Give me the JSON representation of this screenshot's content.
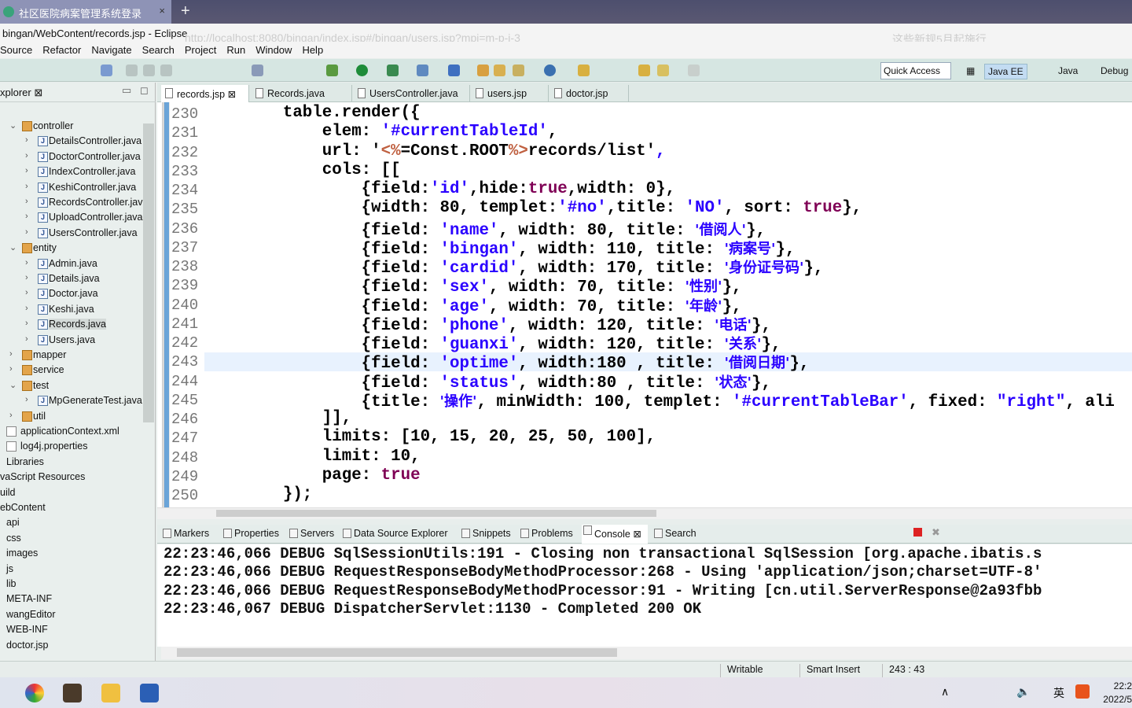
{
  "browser": {
    "tab_title": "社区医院病案管理系统登录",
    "close": "×",
    "new_tab": "+",
    "url": "http://localhost:8080/bingan/index.jsp#/bingan/users.jsp?mpi=m-p-i-3",
    "news": "这些新规5月起施行"
  },
  "window": {
    "title": "bingan/WebContent/records.jsp - Eclipse"
  },
  "menu": [
    "Source",
    "Refactor",
    "Navigate",
    "Search",
    "Project",
    "Run",
    "Window",
    "Help"
  ],
  "toolbar": {
    "quick_access": "Quick Access",
    "perspectives": [
      "Java EE",
      "Java",
      "Debug"
    ]
  },
  "explorer": {
    "title": "xplorer ⊠",
    "items": [
      {
        "label": "controller",
        "level": 1,
        "type": "pkg",
        "open": true
      },
      {
        "label": "DetailsController.java",
        "level": 2,
        "type": "java"
      },
      {
        "label": "DoctorController.java",
        "level": 2,
        "type": "java"
      },
      {
        "label": "IndexController.java",
        "level": 2,
        "type": "java"
      },
      {
        "label": "KeshiController.java",
        "level": 2,
        "type": "java"
      },
      {
        "label": "RecordsController.java",
        "level": 2,
        "type": "java"
      },
      {
        "label": "UploadController.java",
        "level": 2,
        "type": "java"
      },
      {
        "label": "UsersController.java",
        "level": 2,
        "type": "java"
      },
      {
        "label": "entity",
        "level": 1,
        "type": "pkg",
        "open": true
      },
      {
        "label": "Admin.java",
        "level": 2,
        "type": "java"
      },
      {
        "label": "Details.java",
        "level": 2,
        "type": "java"
      },
      {
        "label": "Doctor.java",
        "level": 2,
        "type": "java"
      },
      {
        "label": "Keshi.java",
        "level": 2,
        "type": "java"
      },
      {
        "label": "Records.java",
        "level": 2,
        "type": "java",
        "selected": true
      },
      {
        "label": "Users.java",
        "level": 2,
        "type": "java"
      },
      {
        "label": "mapper",
        "level": 1,
        "type": "pkg"
      },
      {
        "label": "service",
        "level": 1,
        "type": "pkg"
      },
      {
        "label": "test",
        "level": 1,
        "type": "pkg",
        "open": true
      },
      {
        "label": "MpGenerateTest.java",
        "level": 2,
        "type": "java"
      },
      {
        "label": "util",
        "level": 1,
        "type": "pkg"
      },
      {
        "label": "applicationContext.xml",
        "level": 0.5,
        "type": "file"
      },
      {
        "label": "log4j.properties",
        "level": 0.5,
        "type": "file"
      },
      {
        "label": "Libraries",
        "level": 0,
        "type": "none"
      },
      {
        "label": "vaScript Resources",
        "level": -1,
        "type": "none"
      },
      {
        "label": "uild",
        "level": -1,
        "type": "none"
      },
      {
        "label": "ebContent",
        "level": -1,
        "type": "none"
      },
      {
        "label": "api",
        "level": 0,
        "type": "none"
      },
      {
        "label": "css",
        "level": 0,
        "type": "none"
      },
      {
        "label": "images",
        "level": 0,
        "type": "none"
      },
      {
        "label": "js",
        "level": 0,
        "type": "none"
      },
      {
        "label": "lib",
        "level": 0,
        "type": "none"
      },
      {
        "label": "META-INF",
        "level": 0,
        "type": "none"
      },
      {
        "label": "wangEditor",
        "level": 0,
        "type": "none"
      },
      {
        "label": "WEB-INF",
        "level": 0,
        "type": "none"
      },
      {
        "label": "doctor.jsp",
        "level": 0,
        "type": "none"
      }
    ]
  },
  "editor_tabs": [
    {
      "label": "records.jsp ⊠",
      "active": true
    },
    {
      "label": "Records.java"
    },
    {
      "label": "UsersController.java"
    },
    {
      "label": "users.jsp"
    },
    {
      "label": "doctor.jsp"
    }
  ],
  "code": {
    "first_line": 230,
    "current_line": 243,
    "lines": [
      [
        [
          "p",
          "        table.render({"
        ]
      ],
      [
        [
          "p",
          "            elem: "
        ],
        [
          "s",
          "'#currentTableId'"
        ],
        [
          "p",
          ","
        ]
      ],
      [
        [
          "p",
          "            url: '"
        ],
        [
          "j",
          "<%"
        ],
        [
          "p",
          "=Const.ROOT"
        ],
        [
          "j",
          "%>"
        ],
        [
          "p",
          "records/list'"
        ],
        [
          "s",
          ","
        ]
      ],
      [
        [
          "p",
          "            cols: [["
        ]
      ],
      [
        [
          "p",
          "                {field:"
        ],
        [
          "s",
          "'id'"
        ],
        [
          "p",
          ",hide:"
        ],
        [
          "k",
          "true"
        ],
        [
          "p",
          ",width: 0},"
        ]
      ],
      [
        [
          "p",
          "                {width: 80, templet:"
        ],
        [
          "s",
          "'#no'"
        ],
        [
          "p",
          ",title: "
        ],
        [
          "s",
          "'NO'"
        ],
        [
          "p",
          ", sort: "
        ],
        [
          "k",
          "true"
        ],
        [
          "p",
          "},"
        ]
      ],
      [
        [
          "p",
          "                {field: "
        ],
        [
          "s",
          "'name'"
        ],
        [
          "p",
          ", width: 80, title: "
        ],
        [
          "z",
          "'借阅人'"
        ],
        [
          "p",
          "},"
        ]
      ],
      [
        [
          "p",
          "                {field: "
        ],
        [
          "s",
          "'bingan'"
        ],
        [
          "p",
          ", width: 110, title: "
        ],
        [
          "z",
          "'病案号'"
        ],
        [
          "p",
          "},"
        ]
      ],
      [
        [
          "p",
          "                {field: "
        ],
        [
          "s",
          "'cardid'"
        ],
        [
          "p",
          ", width: 170, title: "
        ],
        [
          "z",
          "'身份证号码'"
        ],
        [
          "p",
          "},"
        ]
      ],
      [
        [
          "p",
          "                {field: "
        ],
        [
          "s",
          "'sex'"
        ],
        [
          "p",
          ", width: 70, title: "
        ],
        [
          "z",
          "'性别'"
        ],
        [
          "p",
          "},"
        ]
      ],
      [
        [
          "p",
          "                {field: "
        ],
        [
          "s",
          "'age'"
        ],
        [
          "p",
          ", width: 70, title: "
        ],
        [
          "z",
          "'年龄'"
        ],
        [
          "p",
          "},"
        ]
      ],
      [
        [
          "p",
          "                {field: "
        ],
        [
          "s",
          "'phone'"
        ],
        [
          "p",
          ", width: 120, title: "
        ],
        [
          "z",
          "'电话'"
        ],
        [
          "p",
          "},"
        ]
      ],
      [
        [
          "p",
          "                {field: "
        ],
        [
          "s",
          "'guanxi'"
        ],
        [
          "p",
          ", width: 120, title: "
        ],
        [
          "z",
          "'关系'"
        ],
        [
          "p",
          "},"
        ]
      ],
      [
        [
          "p",
          "                {field: "
        ],
        [
          "s",
          "'optime'"
        ],
        [
          "p",
          ", width:180 , title: "
        ],
        [
          "z",
          "'借阅日期'"
        ],
        [
          "p",
          "},"
        ]
      ],
      [
        [
          "p",
          "                {field: "
        ],
        [
          "s",
          "'status'"
        ],
        [
          "p",
          ", width:80 , title: "
        ],
        [
          "z",
          "'状态'"
        ],
        [
          "p",
          "},"
        ]
      ],
      [
        [
          "p",
          "                {title: "
        ],
        [
          "z",
          "'操作'"
        ],
        [
          "p",
          ", minWidth: 100, templet: "
        ],
        [
          "s",
          "'#currentTableBar'"
        ],
        [
          "p",
          ", fixed: "
        ],
        [
          "s",
          "\"right\""
        ],
        [
          "p",
          ", ali"
        ]
      ],
      [
        [
          "p",
          "            ]],"
        ]
      ],
      [
        [
          "p",
          "            limits: [10, 15, 20, 25, 50, 100],"
        ]
      ],
      [
        [
          "p",
          "            limit: 10,"
        ]
      ],
      [
        [
          "p",
          "            page: "
        ],
        [
          "k",
          "true"
        ]
      ],
      [
        [
          "p",
          "        });"
        ]
      ]
    ]
  },
  "bottom_tabs": [
    "Markers",
    "Properties",
    "Servers",
    "Data Source Explorer",
    "Snippets",
    "Problems",
    "Console ⊠",
    "Search"
  ],
  "console": [
    "22:23:46,066 DEBUG SqlSessionUtils:191 - Closing non transactional SqlSession [org.apache.ibatis.s",
    "22:23:46,066 DEBUG RequestResponseBodyMethodProcessor:268 - Using 'application/json;charset=UTF-8'",
    "22:23:46,066 DEBUG RequestResponseBodyMethodProcessor:91 - Writing [cn.util.ServerResponse@2a93fbb",
    "22:23:46,067 DEBUG DispatcherServlet:1130 - Completed 200 OK"
  ],
  "status": {
    "writable": "Writable",
    "insert": "Smart Insert",
    "position": "243 : 43"
  },
  "taskbar": {
    "time": "22:2",
    "date": "2022/5",
    "ime": "英"
  }
}
